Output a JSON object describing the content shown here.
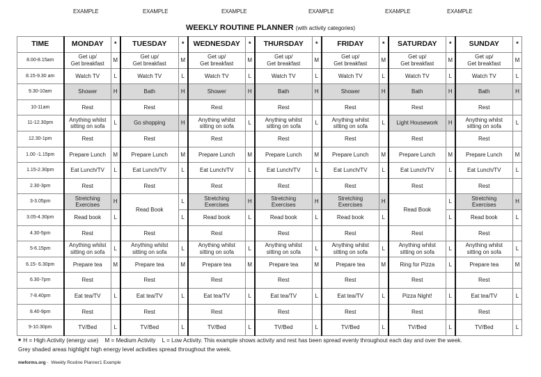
{
  "examples": [
    "EXAMPLE",
    "EXAMPLE",
    "EXAMPLE",
    "EXAMPLE",
    "EXAMPLE",
    "EXAMPLE"
  ],
  "title": {
    "main": "WEEKLY ROUTINE PLANNER",
    "sub": "(with activity categories)"
  },
  "header": {
    "time": "TIME",
    "star": "*",
    "days": [
      "MONDAY",
      "TUESDAY",
      "WEDNESDAY",
      "THURSDAY",
      "FRIDAY",
      "SATURDAY",
      "SUNDAY"
    ]
  },
  "shade_color": "#d9d9d9",
  "rows": [
    {
      "time": "8.00-8.15am",
      "cells": [
        {
          "a": "Get up/\nGet breakfast",
          "c": "M"
        },
        {
          "a": "Get up/\nGet breakfast",
          "c": "M"
        },
        {
          "a": "Get up/\nGet breakfast",
          "c": "M"
        },
        {
          "a": "Get up/\nGet breakfast",
          "c": "M"
        },
        {
          "a": "Get up/\nGet breakfast",
          "c": "M"
        },
        {
          "a": "Get up/\nGet breakfast",
          "c": "M"
        },
        {
          "a": "Get up/\nGet breakfast",
          "c": "M"
        }
      ]
    },
    {
      "time": "8.15-9.30 am",
      "cells": [
        {
          "a": "Watch TV",
          "c": "L"
        },
        {
          "a": "Watch TV",
          "c": "L"
        },
        {
          "a": "Watch TV",
          "c": "L"
        },
        {
          "a": "Watch TV",
          "c": "L"
        },
        {
          "a": "Watch TV",
          "c": "L"
        },
        {
          "a": "Watch TV",
          "c": "L"
        },
        {
          "a": "Watch TV",
          "c": "L"
        }
      ]
    },
    {
      "time": "9.30-10am",
      "cells": [
        {
          "a": "Shower",
          "c": "H",
          "shaded": true
        },
        {
          "a": "Bath",
          "c": "H",
          "shaded": true
        },
        {
          "a": "Shower",
          "c": "H",
          "shaded": true
        },
        {
          "a": "Bath",
          "c": "H",
          "shaded": true
        },
        {
          "a": "Shower",
          "c": "H",
          "shaded": true
        },
        {
          "a": "Bath",
          "c": "H",
          "shaded": true
        },
        {
          "a": "Bath",
          "c": "H",
          "shaded": true
        }
      ]
    },
    {
      "time": "10-11am",
      "cells": [
        {
          "a": "Rest",
          "c": ""
        },
        {
          "a": "Rest",
          "c": ""
        },
        {
          "a": "Rest",
          "c": ""
        },
        {
          "a": "Rest",
          "c": ""
        },
        {
          "a": "Rest",
          "c": ""
        },
        {
          "a": "Rest",
          "c": ""
        },
        {
          "a": "Rest",
          "c": ""
        }
      ]
    },
    {
      "time": "11-12.30pm",
      "cells": [
        {
          "a": "Anything whilst\nsitting on sofa",
          "c": "L"
        },
        {
          "a": "Go shopping",
          "c": "H",
          "shaded": true
        },
        {
          "a": "Anything whilst\nsitting on sofa",
          "c": "L"
        },
        {
          "a": "Anything whilst\nsitting on sofa",
          "c": "L"
        },
        {
          "a": "Anything whilst\nsitting on sofa",
          "c": "L"
        },
        {
          "a": "Light Housework",
          "c": "H",
          "shaded": true
        },
        {
          "a": "Anything whilst\nsitting on sofa",
          "c": "L"
        }
      ]
    },
    {
      "time": "12.30-1pm",
      "cells": [
        {
          "a": "Rest",
          "c": ""
        },
        {
          "a": "Rest",
          "c": ""
        },
        {
          "a": "Rest",
          "c": ""
        },
        {
          "a": "Rest",
          "c": ""
        },
        {
          "a": "Rest",
          "c": ""
        },
        {
          "a": "Rest",
          "c": ""
        },
        {
          "a": "Rest",
          "c": ""
        }
      ]
    },
    {
      "time": "1.00 -1.15pm",
      "cells": [
        {
          "a": "Prepare Lunch",
          "c": "M"
        },
        {
          "a": "Prepare Lunch",
          "c": "M"
        },
        {
          "a": "Prepare Lunch",
          "c": "M"
        },
        {
          "a": "Prepare Lunch",
          "c": "M"
        },
        {
          "a": "Prepare Lunch",
          "c": "M"
        },
        {
          "a": "Prepare Lunch",
          "c": "M"
        },
        {
          "a": "Prepare Lunch",
          "c": "M"
        }
      ]
    },
    {
      "time": "1.15-2.30pm",
      "cells": [
        {
          "a": "Eat Lunch/TV",
          "c": "L"
        },
        {
          "a": "Eat Lunch/TV",
          "c": "L"
        },
        {
          "a": "Eat Lunch/TV",
          "c": "L"
        },
        {
          "a": "Eat Lunch/TV",
          "c": "L"
        },
        {
          "a": "Eat Lunch/TV",
          "c": "L"
        },
        {
          "a": "Eat Lunch/TV",
          "c": "L"
        },
        {
          "a": "Eat Lunch/TV",
          "c": "L"
        }
      ]
    },
    {
      "time": "2.30-3pm",
      "cells": [
        {
          "a": "Rest",
          "c": ""
        },
        {
          "a": "Rest",
          "c": ""
        },
        {
          "a": "Rest",
          "c": ""
        },
        {
          "a": "Rest",
          "c": ""
        },
        {
          "a": "Rest",
          "c": ""
        },
        {
          "a": "Rest",
          "c": ""
        },
        {
          "a": "Rest",
          "c": ""
        }
      ]
    },
    {
      "time": "3-3.05pm",
      "cells": [
        {
          "a": "Stretching\nExercises",
          "c": "H",
          "shaded": true
        },
        {
          "a": "Read Book",
          "c": "L",
          "span": 2
        },
        {
          "a": "Stretching\nExercises",
          "c": "H",
          "shaded": true
        },
        {
          "a": "Stretching\nExercises",
          "c": "H",
          "shaded": true
        },
        {
          "a": "Stretching\nExercises",
          "c": "H",
          "shaded": true
        },
        {
          "a": "Read Book",
          "c": "L",
          "span": 2
        },
        {
          "a": "Stretching\nExercises",
          "c": "H",
          "shaded": true
        }
      ]
    },
    {
      "time": "3.05-4.30pm",
      "cells": [
        {
          "a": "Read book",
          "c": "L"
        },
        {
          "skip": true,
          "c": "L"
        },
        {
          "a": "Read book",
          "c": "L"
        },
        {
          "a": "Read book",
          "c": "L"
        },
        {
          "a": "Read book",
          "c": "L"
        },
        {
          "skip": true,
          "c": "L"
        },
        {
          "a": "Read book",
          "c": "L"
        }
      ]
    },
    {
      "time": "4.30-5pm",
      "cells": [
        {
          "a": "Rest",
          "c": ""
        },
        {
          "a": "Rest",
          "c": ""
        },
        {
          "a": "Rest",
          "c": ""
        },
        {
          "a": "Rest",
          "c": ""
        },
        {
          "a": "Rest",
          "c": ""
        },
        {
          "a": "Rest",
          "c": ""
        },
        {
          "a": "Rest",
          "c": ""
        }
      ]
    },
    {
      "time": "5-6.15pm",
      "cells": [
        {
          "a": "Anything whilst\nsitting on sofa",
          "c": "L"
        },
        {
          "a": "Anything whilst\nsitting on sofa",
          "c": "L"
        },
        {
          "a": "Anything whilst\nsitting on sofa",
          "c": "L"
        },
        {
          "a": "Anything whilst\nsitting on sofa",
          "c": "L"
        },
        {
          "a": "Anything whilst\nsitting on sofa",
          "c": "L"
        },
        {
          "a": "Anything whilst\nsitting on sofa",
          "c": "L"
        },
        {
          "a": "Anything whilst\nsitting on sofa",
          "c": "L"
        }
      ]
    },
    {
      "time": "6.15- 6.30pm",
      "cells": [
        {
          "a": "Prepare tea",
          "c": "M"
        },
        {
          "a": "Prepare tea",
          "c": "M"
        },
        {
          "a": "Prepare tea",
          "c": "M"
        },
        {
          "a": "Prepare tea",
          "c": "M"
        },
        {
          "a": "Prepare tea",
          "c": "M"
        },
        {
          "a": "Ring for Pizza",
          "c": "L"
        },
        {
          "a": "Prepare tea",
          "c": "M"
        }
      ]
    },
    {
      "time": "6.30-7pm",
      "cells": [
        {
          "a": "Rest",
          "c": ""
        },
        {
          "a": "Rest",
          "c": ""
        },
        {
          "a": "Rest",
          "c": ""
        },
        {
          "a": "Rest",
          "c": ""
        },
        {
          "a": "Rest",
          "c": ""
        },
        {
          "a": "Rest",
          "c": ""
        },
        {
          "a": "Rest",
          "c": ""
        }
      ]
    },
    {
      "time": "7-8.40pm",
      "cells": [
        {
          "a": "Eat tea/TV",
          "c": "L"
        },
        {
          "a": "Eat tea/TV",
          "c": "L"
        },
        {
          "a": "Eat tea/TV",
          "c": "L"
        },
        {
          "a": "Eat tea/TV",
          "c": "L"
        },
        {
          "a": "Eat tea/TV",
          "c": "L"
        },
        {
          "a": "Pizza Night!",
          "c": "L"
        },
        {
          "a": "Eat tea/TV",
          "c": "L"
        }
      ]
    },
    {
      "time": "8.40-9pm",
      "cells": [
        {
          "a": "Rest",
          "c": ""
        },
        {
          "a": "Rest",
          "c": ""
        },
        {
          "a": "Rest",
          "c": ""
        },
        {
          "a": "Rest",
          "c": ""
        },
        {
          "a": "Rest",
          "c": ""
        },
        {
          "a": "Rest",
          "c": ""
        },
        {
          "a": "Rest",
          "c": ""
        }
      ]
    },
    {
      "time": "9-10.30pm",
      "cells": [
        {
          "a": "TV/Bed",
          "c": "L"
        },
        {
          "a": "TV/Bed",
          "c": "L"
        },
        {
          "a": "TV/Bed",
          "c": "L"
        },
        {
          "a": "TV/Bed",
          "c": "L"
        },
        {
          "a": "TV/Bed",
          "c": "L"
        },
        {
          "a": "TV/Bed",
          "c": "L"
        },
        {
          "a": "TV/Bed",
          "c": "L"
        }
      ]
    }
  ],
  "footnote": {
    "asterisk": "*",
    "line1": "H = High Activity (energy use)    M = Medium Activity    L = Low Activity. This example shows activity and rest has been spread evenly throughout each day and over the week.",
    "line2": "Grey shaded areas highlight high energy level activities spread throughout the week."
  },
  "source": {
    "site": "meforms.org",
    "sep": " -  ",
    "label": "Weekly Routine Planner1 Example"
  }
}
